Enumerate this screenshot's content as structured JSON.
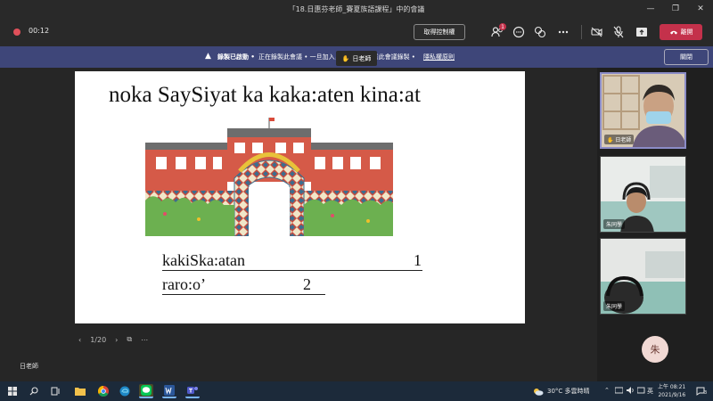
{
  "window": {
    "title": "「18.日惠芬老師_賽夏族語課程」中的會議",
    "minimize": "—",
    "maximize": "❐",
    "close": "✕"
  },
  "toolbar": {
    "timer": "00:12",
    "control_label": "取得控制權",
    "participants_badge": "1",
    "leave_label": "離開"
  },
  "banner": {
    "warning_icon": "▲",
    "title": "錄製已啟動 •",
    "message": "正在錄製此會議 • 一旦加入，即表示您同意此會議錄製 •",
    "link": "隱私權原則",
    "close_label": "關閉"
  },
  "speaker": {
    "hand_icon": "✋",
    "name": "日老師"
  },
  "slide": {
    "title": "noka SaySiyat ka kaka:aten kina:at",
    "rows": [
      {
        "label": "kakiSka:atan",
        "number": "1"
      },
      {
        "label": "raro:o’",
        "number": "2"
      }
    ]
  },
  "slide_nav": {
    "prev": "‹",
    "page": "1/20",
    "next": "›",
    "grid": "⧉",
    "more": "⋯"
  },
  "presenter": "日老師",
  "participants": [
    {
      "name": "✋ 日老師"
    },
    {
      "name": "朱同學"
    },
    {
      "name": "朱同學"
    }
  ],
  "avatar_initial": "朱",
  "taskbar": {
    "weather": "30°C 多雲時晴",
    "lang": "英",
    "time": "上午 08:21",
    "date": "2021/9/16",
    "notification": "3"
  },
  "colors": {
    "banner": "#3e4679",
    "leave": "#c4314b",
    "accent": "#8b8cc7"
  }
}
